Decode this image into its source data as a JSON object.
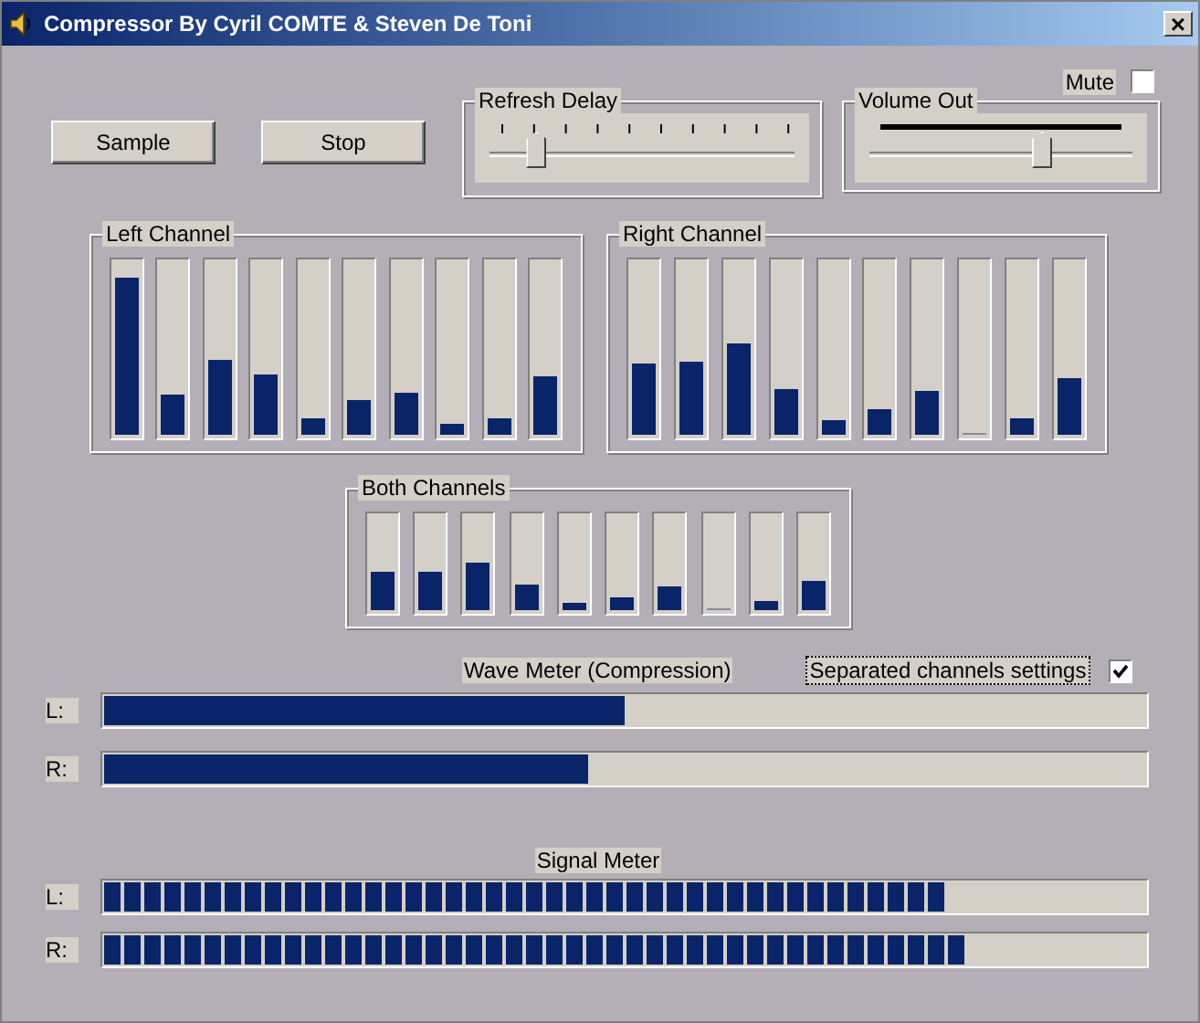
{
  "window": {
    "title": "Compressor By Cyril COMTE & Steven De Toni",
    "close": "×"
  },
  "buttons": [
    {
      "label": "Sample"
    },
    {
      "label": "Stop"
    }
  ],
  "refresh_delay": {
    "label": "Refresh Delay",
    "level": 0.12
  },
  "mute": {
    "label": "Mute",
    "checked": false
  },
  "volume_out": {
    "label": "Volume Out",
    "level": 0.67
  },
  "channel_groups": [
    {
      "label": "Left Channel",
      "bars": [
        {
          "level": 0.92
        },
        {
          "level": 0.23
        },
        {
          "level": 0.44
        },
        {
          "level": 0.35
        },
        {
          "level": 0.1
        },
        {
          "level": 0.2
        },
        {
          "level": 0.24
        },
        {
          "level": 0.06
        },
        {
          "level": 0.1
        },
        {
          "level": 0.34
        }
      ]
    },
    {
      "label": "Right Channel",
      "bars": [
        {
          "level": 0.41
        },
        {
          "level": 0.43
        },
        {
          "level": 0.53
        },
        {
          "level": 0.27
        },
        {
          "level": 0.08
        },
        {
          "level": 0.15
        },
        {
          "level": 0.26
        },
        {
          "level": 0
        },
        {
          "level": 0.1
        },
        {
          "level": 0.33
        }
      ]
    },
    {
      "label": "Both Channels",
      "bars": [
        {
          "level": 0.42
        },
        {
          "level": 0.42
        },
        {
          "level": 0.51
        },
        {
          "level": 0.27
        },
        {
          "level": 0.08
        },
        {
          "level": 0.14
        },
        {
          "level": 0.25
        },
        {
          "level": 0
        },
        {
          "level": 0.1
        },
        {
          "level": 0.32
        }
      ]
    }
  ],
  "wave_meter": {
    "title": "Wave Meter (Compression)",
    "rows": [
      {
        "label": "L:",
        "level": 0.5
      },
      {
        "label": "R:",
        "level": 0.465
      }
    ]
  },
  "separated_channels": {
    "label": "Separated channels settings",
    "checked": true
  },
  "signal_meter": {
    "title": "Signal Meter",
    "rows": [
      {
        "label": "L:",
        "level": 0.81
      },
      {
        "label": "R:",
        "level": 0.83
      }
    ]
  }
}
